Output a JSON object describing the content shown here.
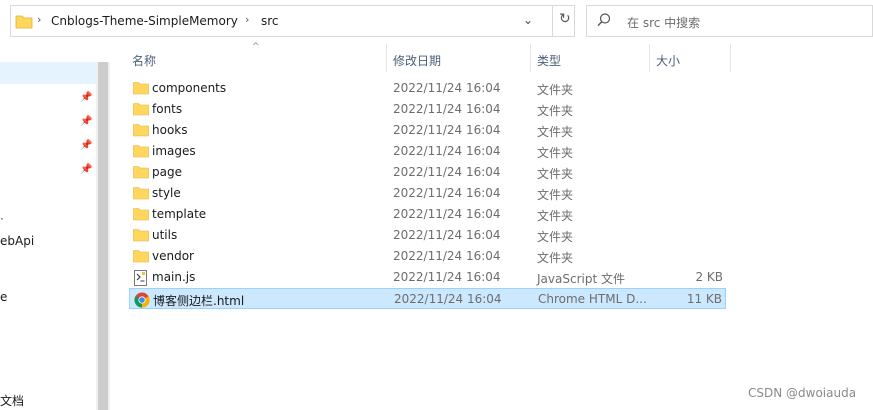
{
  "address_bar": {
    "crumbs": [
      "Cnblogs-Theme-SimpleMemory",
      "src"
    ]
  },
  "search": {
    "placeholder": "在 src 中搜索"
  },
  "nav": {
    "partial_items": [
      "ebApi",
      "e",
      "文档"
    ]
  },
  "columns": {
    "name": "名称",
    "date": "修改日期",
    "type": "类型",
    "size": "大小"
  },
  "files": [
    {
      "name": "components",
      "date": "2022/11/24 16:04",
      "type": "文件夹",
      "size": "",
      "icon": "folder-icon"
    },
    {
      "name": "fonts",
      "date": "2022/11/24 16:04",
      "type": "文件夹",
      "size": "",
      "icon": "folder-icon"
    },
    {
      "name": "hooks",
      "date": "2022/11/24 16:04",
      "type": "文件夹",
      "size": "",
      "icon": "folder-icon"
    },
    {
      "name": "images",
      "date": "2022/11/24 16:04",
      "type": "文件夹",
      "size": "",
      "icon": "folder-icon"
    },
    {
      "name": "page",
      "date": "2022/11/24 16:04",
      "type": "文件夹",
      "size": "",
      "icon": "folder-icon"
    },
    {
      "name": "style",
      "date": "2022/11/24 16:04",
      "type": "文件夹",
      "size": "",
      "icon": "folder-icon"
    },
    {
      "name": "template",
      "date": "2022/11/24 16:04",
      "type": "文件夹",
      "size": "",
      "icon": "folder-icon"
    },
    {
      "name": "utils",
      "date": "2022/11/24 16:04",
      "type": "文件夹",
      "size": "",
      "icon": "folder-icon"
    },
    {
      "name": "vendor",
      "date": "2022/11/24 16:04",
      "type": "文件夹",
      "size": "",
      "icon": "folder-icon"
    },
    {
      "name": "main.js",
      "date": "2022/11/24 16:04",
      "type": "JavaScript 文件",
      "size": "2 KB",
      "icon": "js-file-icon"
    },
    {
      "name": "博客侧边栏.html",
      "date": "2022/11/24 16:04",
      "type": "Chrome HTML D...",
      "size": "11 KB",
      "icon": "chrome-html-icon",
      "selected": true
    }
  ],
  "watermark": "CSDN @dwoiauda",
  "colors": {
    "selection": "#cce8ff",
    "selection_border": "#99d1ff",
    "folder": "#ffd75e",
    "header_text": "#4c607a"
  }
}
